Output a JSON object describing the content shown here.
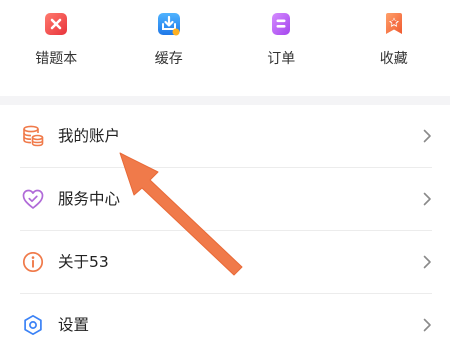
{
  "quick": [
    {
      "label": "错题本",
      "icon": "close-icon",
      "color": "#f0484a"
    },
    {
      "label": "缓存",
      "icon": "download-icon",
      "color": "#2e8cf2"
    },
    {
      "label": "订单",
      "icon": "order-icon",
      "color": "#b35ef2"
    },
    {
      "label": "收藏",
      "icon": "bookmark-star-icon",
      "color": "#f46b45"
    }
  ],
  "menu": [
    {
      "label": "我的账户",
      "icon": "coins-icon"
    },
    {
      "label": "服务中心",
      "icon": "heart-check-icon"
    },
    {
      "label": "关于53",
      "icon": "info-icon"
    },
    {
      "label": "设置",
      "icon": "gear-icon"
    }
  ],
  "colors": {
    "accent": "#f07a4a",
    "settings": "#3b82f6",
    "service": "#b06ad8",
    "divider": "#ececec",
    "section_bg": "#f4f4f6"
  }
}
